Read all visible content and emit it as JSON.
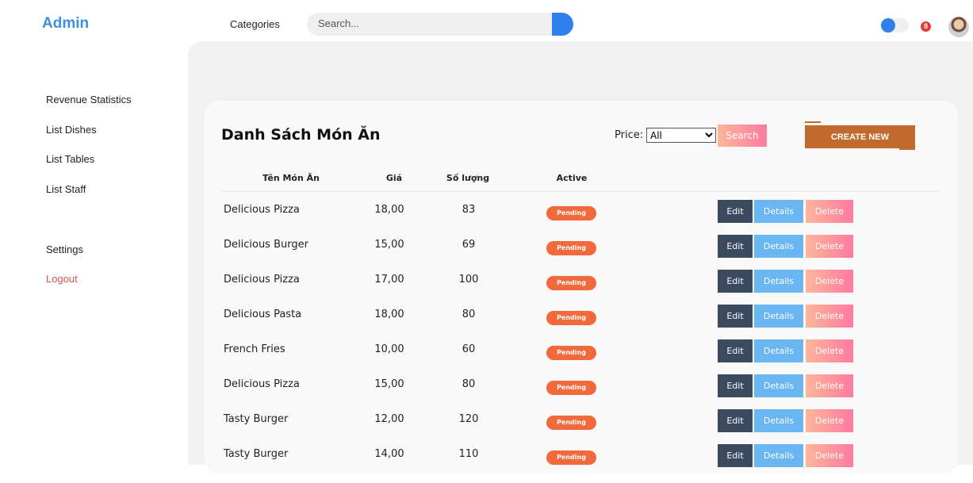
{
  "header": {
    "brand": "Admin",
    "categories_label": "Categories",
    "search_placeholder": "Search...",
    "notification_count": "8",
    "accent_color": "#2f80ed"
  },
  "sidebar": {
    "items": [
      {
        "label": "Revenue Statistics"
      },
      {
        "label": "List Dishes"
      },
      {
        "label": "List Tables"
      },
      {
        "label": "List Staff"
      },
      {
        "label": "Settings"
      },
      {
        "label": "Logout"
      }
    ]
  },
  "main": {
    "title": "Danh Sách Món Ăn",
    "price_filter_label": "Price:",
    "price_filter_value": "All",
    "search_button": "Search",
    "create_button": "CREATE NEW",
    "columns": [
      "Tên Món Ăn",
      "Giá",
      "Số lượng",
      "Active"
    ],
    "actions": {
      "edit": "Edit",
      "details": "Details",
      "delete": "Delete"
    },
    "rows": [
      {
        "name": "Delicious Pizza",
        "price": "18,00",
        "qty": "83",
        "status": "Pending"
      },
      {
        "name": "Delicious Burger",
        "price": "15,00",
        "qty": "69",
        "status": "Pending"
      },
      {
        "name": "Delicious Pizza",
        "price": "17,00",
        "qty": "100",
        "status": "Pending"
      },
      {
        "name": "Delicious Pasta",
        "price": "18,00",
        "qty": "80",
        "status": "Pending"
      },
      {
        "name": "French Fries",
        "price": "10,00",
        "qty": "60",
        "status": "Pending"
      },
      {
        "name": "Delicious Pizza",
        "price": "15,00",
        "qty": "80",
        "status": "Pending"
      },
      {
        "name": "Tasty Burger",
        "price": "12,00",
        "qty": "120",
        "status": "Pending"
      },
      {
        "name": "Tasty Burger",
        "price": "14,00",
        "qty": "110",
        "status": "Pending"
      }
    ]
  }
}
